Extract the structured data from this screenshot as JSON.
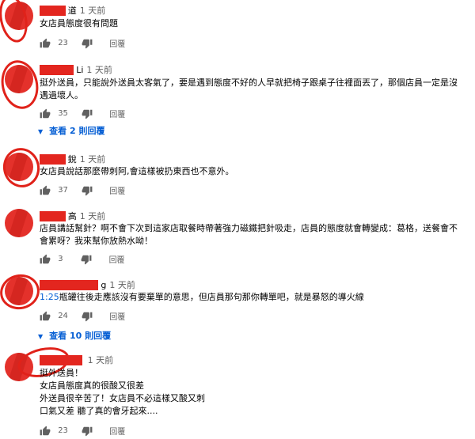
{
  "comments": [
    {
      "author": "",
      "author_visible": "道",
      "time": "1 天前",
      "text": "女店員態度很有問題",
      "likes": "23",
      "reply_label": "回覆"
    },
    {
      "author": "",
      "author_visible": "Li",
      "time": "1 天前",
      "text": "挺外送員，只能說外送員太客氣了，要是遇到態度不好的人早就把椅子跟桌子往裡面丟了，那個店員一定是沒遇過壞人。",
      "likes": "35",
      "reply_label": "回覆",
      "view_replies": "查看 2 則回覆"
    },
    {
      "author": "",
      "author_visible": "銳",
      "time": "1 天前",
      "text": "女店員說話那麼帶刺阿,會這樣被扔東西也不意外。",
      "likes": "37",
      "reply_label": "回覆"
    },
    {
      "author": "",
      "author_visible": "高",
      "time": "1 天前",
      "text": "店員講話幫針？啊不會下次到這家店取餐時帶著強力磁鐵把針吸走，店員的態度就會轉變成：葛格，送餐會不會累呀？我來幫你放熱水呦！",
      "likes": "3",
      "reply_label": "回覆"
    },
    {
      "author": "",
      "author_visible": "g",
      "time": "1 天前",
      "timestamp_link": "1:25",
      "text": "瓶罐往後走應該沒有要棄單的意思，但店員那句那你轉單吧，就是暴怒的導火線",
      "likes": "24",
      "reply_label": "回覆",
      "view_replies": "查看 10 則回覆"
    },
    {
      "author": "",
      "author_visible": "",
      "time": "1 天前",
      "text_lines": [
        "挺外送員！",
        "女店員態度真的很酸又很差",
        "外送員很辛苦了！女店員不必這樣又酸又刺",
        "口氣又差 聽了真的會牙起來...."
      ],
      "likes": "23",
      "reply_label": "回覆"
    }
  ],
  "icons": {
    "like": "thumbs-up-icon",
    "dislike": "thumbs-down-icon",
    "expand": "caret-down-icon"
  },
  "colors": {
    "link": "#065fd4",
    "meta": "#606060",
    "redaction": "#e3261f"
  }
}
